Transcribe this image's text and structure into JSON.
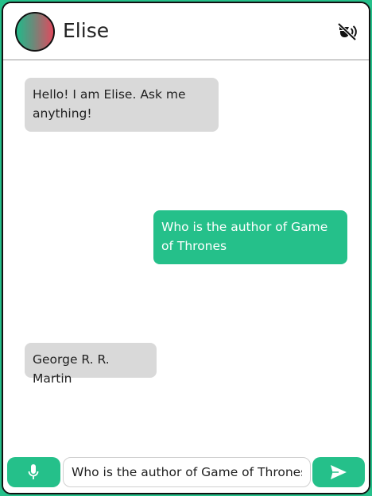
{
  "colors": {
    "accent": "#25c08a",
    "bot_bubble": "#d9d9d9",
    "page_bg": "#25c08a"
  },
  "header": {
    "name": "Elise",
    "avatar_icon": "avatar-gradient",
    "mute_icon": "speaker-muted-icon"
  },
  "messages": [
    {
      "from": "bot",
      "text": "Hello! I am Elise. Ask me anything!"
    },
    {
      "from": "user",
      "text": "Who is the author of Game of Thrones"
    },
    {
      "from": "bot",
      "text": "George R. R. Martin"
    }
  ],
  "input_bar": {
    "mic_icon": "microphone-icon",
    "value": "Who is the author of Game of Thrones",
    "send_icon": "send-icon"
  }
}
